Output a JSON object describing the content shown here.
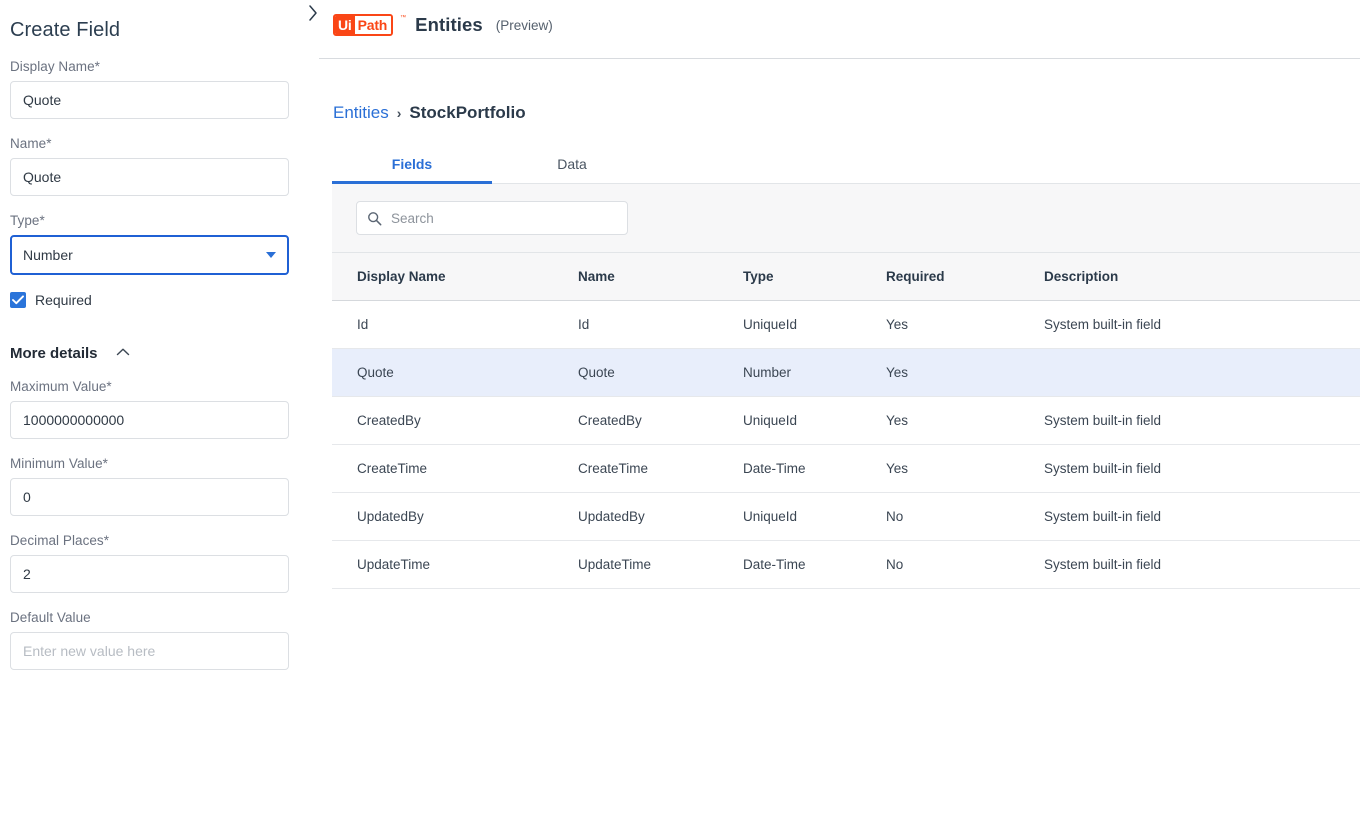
{
  "sidebar": {
    "title": "Create Field",
    "fields": [
      {
        "label": "Display Name*",
        "value": "Quote",
        "name": "display-name"
      },
      {
        "label": "Name*",
        "value": "Quote",
        "name": "name"
      }
    ],
    "type_field": {
      "label": "Type*",
      "value": "Number",
      "caret_icon": "chevron-down-icon"
    },
    "required_checkbox": {
      "label": "Required",
      "checked": true
    },
    "more_details": {
      "title": "More details",
      "caret_icon": "chevron-up-icon",
      "expanded": true
    },
    "details_fields": [
      {
        "label": "Maximum Value*",
        "value": "1000000000000",
        "name": "maximum-value"
      },
      {
        "label": "Minimum Value*",
        "value": "0",
        "name": "minimum-value"
      },
      {
        "label": "Decimal Places*",
        "value": "2",
        "name": "decimal-places"
      }
    ],
    "default_value": {
      "label": "Default Value",
      "value": "",
      "placeholder": "Enter new value here"
    }
  },
  "panel_toggle": {
    "icon": "chevron-right-icon"
  },
  "header": {
    "logo": {
      "mark": "Ui",
      "word": "Path",
      "tm": "™"
    },
    "app_name": "Entities",
    "preview_label": "(Preview)"
  },
  "breadcrumb": {
    "root": "Entities",
    "separator": "›",
    "current": "StockPortfolio"
  },
  "tabs": [
    {
      "label": "Fields",
      "active": true
    },
    {
      "label": "Data",
      "active": false
    }
  ],
  "search": {
    "placeholder": "Search",
    "value": "",
    "icon": "search-icon"
  },
  "table": {
    "columns": [
      "Display Name",
      "Name",
      "Type",
      "Required",
      "Description"
    ],
    "rows": [
      {
        "display_name": "Id",
        "name": "Id",
        "type": "UniqueId",
        "required": "Yes",
        "description": "System built-in field",
        "selected": false
      },
      {
        "display_name": "Quote",
        "name": "Quote",
        "type": "Number",
        "required": "Yes",
        "description": "",
        "selected": true
      },
      {
        "display_name": "CreatedBy",
        "name": "CreatedBy",
        "type": "UniqueId",
        "required": "Yes",
        "description": "System built-in field",
        "selected": false
      },
      {
        "display_name": "CreateTime",
        "name": "CreateTime",
        "type": "Date-Time",
        "required": "Yes",
        "description": "System built-in field",
        "selected": false
      },
      {
        "display_name": "UpdatedBy",
        "name": "UpdatedBy",
        "type": "UniqueId",
        "required": "No",
        "description": "System built-in field",
        "selected": false
      },
      {
        "display_name": "UpdateTime",
        "name": "UpdateTime",
        "type": "Date-Time",
        "required": "No",
        "description": "System built-in field",
        "selected": false
      }
    ]
  },
  "colors": {
    "brand_orange": "#fa4616",
    "accent_blue": "#2a6fd6",
    "focus_blue": "#1f60d4",
    "row_selected": "#e8eefb",
    "toolbar_gray": "#f7f7f8"
  }
}
